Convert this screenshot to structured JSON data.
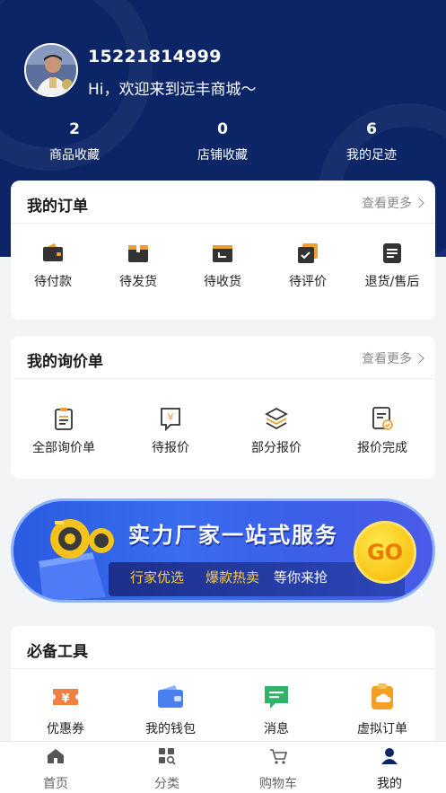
{
  "user": {
    "phone": "15221814999",
    "welcome": "Hi，欢迎来到远丰商城～"
  },
  "stats": [
    {
      "value": "2",
      "label": "商品收藏"
    },
    {
      "value": "0",
      "label": "店铺收藏"
    },
    {
      "value": "6",
      "label": "我的足迹"
    }
  ],
  "orders": {
    "title": "我的订单",
    "more": "查看更多",
    "items": [
      {
        "label": "待付款",
        "icon": "wallet-icon"
      },
      {
        "label": "待发货",
        "icon": "box-icon"
      },
      {
        "label": "待收货",
        "icon": "receive-icon"
      },
      {
        "label": "待评价",
        "icon": "review-icon"
      },
      {
        "label": "退货/售后",
        "icon": "return-icon"
      }
    ]
  },
  "inquiries": {
    "title": "我的询价单",
    "more": "查看更多",
    "items": [
      {
        "label": "全部询价单",
        "icon": "clipboard-icon"
      },
      {
        "label": "待报价",
        "icon": "yuan-doc-icon"
      },
      {
        "label": "部分报价",
        "icon": "layers-icon"
      },
      {
        "label": "报价完成",
        "icon": "doc-check-icon"
      }
    ]
  },
  "banner": {
    "title": "实力厂家一站式服务",
    "sub1": "行家优选",
    "sub2": "爆款热卖",
    "sub3": "等你来抢",
    "go": "GO"
  },
  "tools": {
    "title": "必备工具",
    "items": [
      {
        "label": "优惠券",
        "icon": "coupon-icon"
      },
      {
        "label": "我的钱包",
        "icon": "purse-icon"
      },
      {
        "label": "消息",
        "icon": "message-icon"
      },
      {
        "label": "虚拟订单",
        "icon": "virtual-order-icon"
      }
    ]
  },
  "tabs": [
    {
      "label": "首页",
      "icon": "home-icon"
    },
    {
      "label": "分类",
      "icon": "category-icon"
    },
    {
      "label": "购物车",
      "icon": "cart-icon"
    },
    {
      "label": "我的",
      "icon": "profile-icon"
    }
  ],
  "colors": {
    "header_bg": "#0b2566",
    "accent": "#0b2566",
    "banner_blue": "#3a6cf0",
    "banner_yellow": "#ffcc33"
  }
}
